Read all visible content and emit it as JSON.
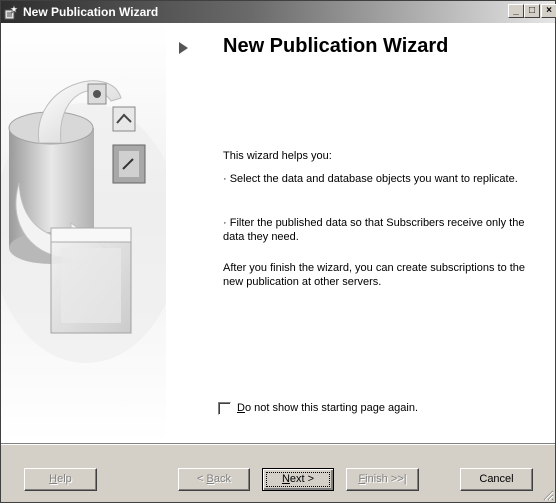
{
  "window": {
    "title": "New Publication Wizard",
    "controls": {
      "minimize": "_",
      "maximize": "□",
      "close": "×"
    }
  },
  "page": {
    "heading": "New Publication Wizard",
    "intro": "This wizard helps you:",
    "bullet1": "· Select the data and database objects you want to replicate.",
    "bullet2": "· Filter the published data so that Subscribers receive only the data they need.",
    "outro": "After you finish the wizard, you can create subscriptions to the new publication at other servers."
  },
  "checkbox": {
    "label_mnemonic": "D",
    "label_rest": "o not show this starting page again.",
    "checked": false
  },
  "buttons": {
    "help": {
      "mnemonic": "H",
      "rest": "elp"
    },
    "back": {
      "prefix": "< ",
      "mnemonic": "B",
      "rest": "ack"
    },
    "next": {
      "mnemonic": "N",
      "rest": "ext >"
    },
    "finish": {
      "mnemonic": "F",
      "rest": "inish >>|"
    },
    "cancel": "Cancel"
  },
  "icons": {
    "title_icon": "wizard-icon",
    "step_marker": "play-triangle-icon",
    "illustration": "database-publish-illustration"
  }
}
